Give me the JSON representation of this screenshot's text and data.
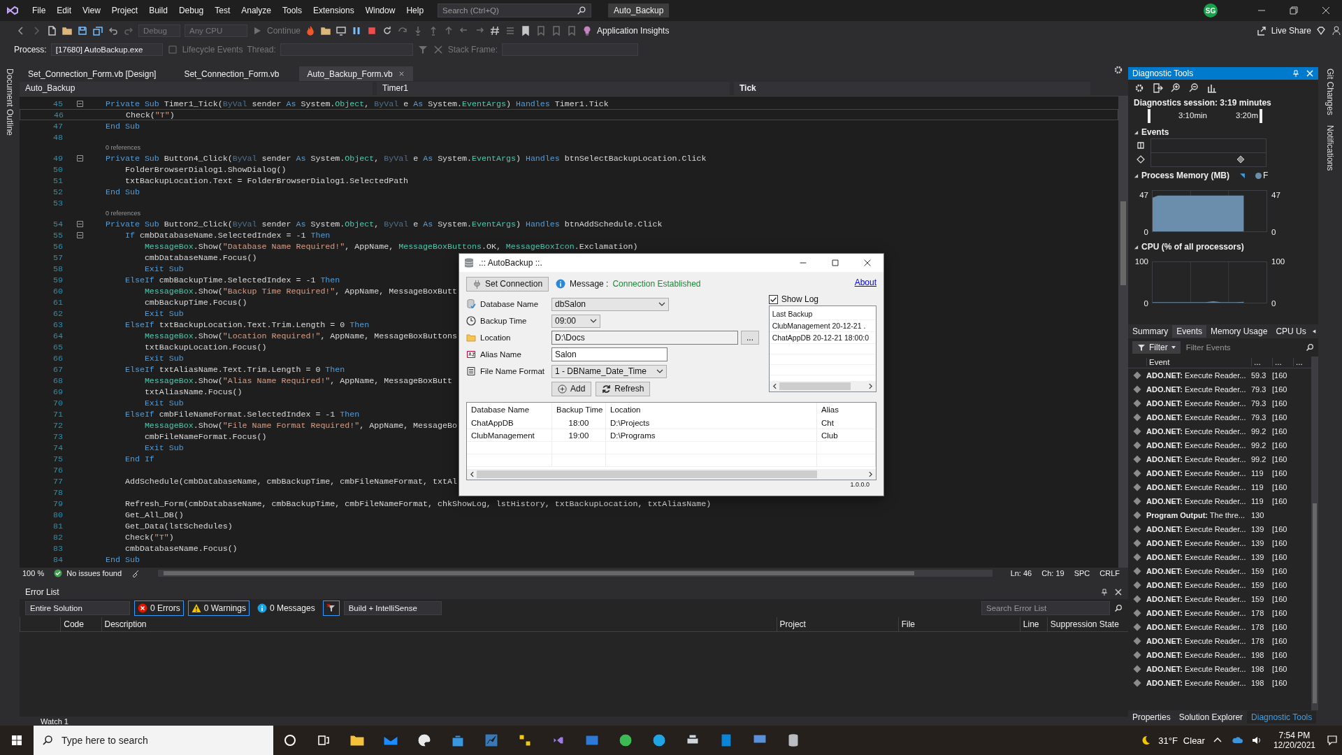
{
  "window": {
    "title": "Auto_Backup"
  },
  "menu": [
    "File",
    "Edit",
    "View",
    "Project",
    "Build",
    "Debug",
    "Test",
    "Analyze",
    "Tools",
    "Extensions",
    "Window",
    "Help"
  ],
  "search": {
    "placeholder": "Search (Ctrl+Q)"
  },
  "account": {
    "initials": "SG"
  },
  "toolbar": {
    "configuration": "Debug",
    "platform": "Any CPU",
    "continue": "Continue",
    "insights": "Application Insights",
    "live_share": "Live Share"
  },
  "debug_bar": {
    "process_label": "Process:",
    "process": "[17680] AutoBackup.exe",
    "lifecycle": "Lifecycle Events",
    "thread_label": "Thread:",
    "stack_label": "Stack Frame:"
  },
  "side_tabs_left": [
    "Document Outline"
  ],
  "side_tabs_right": [
    "Git Changes",
    "Notifications"
  ],
  "document_tabs": [
    {
      "label": "Set_Connection_Form.vb [Design]",
      "selected": false
    },
    {
      "label": "Set_Connection_Form.vb",
      "selected": false
    },
    {
      "label": "Auto_Backup_Form.vb",
      "selected": true
    }
  ],
  "navigation": {
    "project": "Auto_Backup",
    "object": "Timer1",
    "member": "Tick"
  },
  "editor": {
    "lines": [
      {
        "kind": "code",
        "n": "45",
        "fold": true,
        "current": false,
        "segs": [
          {
            "kind": "keyword",
            "text": "Private Sub "
          },
          {
            "kind": "plain",
            "text": "Timer1_Tick("
          },
          {
            "kind": "param",
            "text": "ByVal"
          },
          {
            "kind": "plain",
            "text": " sender "
          },
          {
            "kind": "keyword",
            "text": "As "
          },
          {
            "kind": "plain",
            "text": "System."
          },
          {
            "kind": "type",
            "text": "Object"
          },
          {
            "kind": "plain",
            "text": ", "
          },
          {
            "kind": "param",
            "text": "ByVal"
          },
          {
            "kind": "plain",
            "text": " e "
          },
          {
            "kind": "keyword",
            "text": "As "
          },
          {
            "kind": "plain",
            "text": "System."
          },
          {
            "kind": "type",
            "text": "EventArgs"
          },
          {
            "kind": "plain",
            "text": ") "
          },
          {
            "kind": "keyword",
            "text": "Handles "
          },
          {
            "kind": "plain",
            "text": "Timer1.Tick"
          }
        ]
      },
      {
        "kind": "code",
        "n": "46",
        "fold": false,
        "current": true,
        "segs": [
          {
            "kind": "plain",
            "text": "    Check("
          },
          {
            "kind": "string",
            "text": "\"T\""
          },
          {
            "kind": "plain",
            "text": ")"
          }
        ]
      },
      {
        "kind": "code",
        "n": "47",
        "fold": false,
        "current": false,
        "segs": [
          {
            "kind": "keyword",
            "text": "End Sub"
          }
        ]
      },
      {
        "kind": "code",
        "n": "48",
        "fold": false,
        "current": false
      },
      {
        "kind": "lens",
        "text": "0 references"
      },
      {
        "kind": "code",
        "n": "49",
        "fold": true,
        "current": false,
        "segs": [
          {
            "kind": "keyword",
            "text": "Private Sub "
          },
          {
            "kind": "plain",
            "text": "Button4_Click("
          },
          {
            "kind": "param",
            "text": "ByVal"
          },
          {
            "kind": "plain",
            "text": " sender "
          },
          {
            "kind": "keyword",
            "text": "As "
          },
          {
            "kind": "plain",
            "text": "System."
          },
          {
            "kind": "type",
            "text": "Object"
          },
          {
            "kind": "plain",
            "text": ", "
          },
          {
            "kind": "param",
            "text": "ByVal"
          },
          {
            "kind": "plain",
            "text": " e "
          },
          {
            "kind": "keyword",
            "text": "As "
          },
          {
            "kind": "plain",
            "text": "System."
          },
          {
            "kind": "type",
            "text": "EventArgs"
          },
          {
            "kind": "plain",
            "text": ") "
          },
          {
            "kind": "keyword",
            "text": "Handles "
          },
          {
            "kind": "plain",
            "text": "btnSelectBackupLocation.Click"
          }
        ]
      },
      {
        "kind": "code",
        "n": "50",
        "fold": false,
        "current": false,
        "segs": [
          {
            "kind": "plain",
            "text": "    FolderBrowserDialog1.ShowDialog()"
          }
        ]
      },
      {
        "kind": "code",
        "n": "51",
        "fold": false,
        "current": false,
        "segs": [
          {
            "kind": "plain",
            "text": "    txtBackupLocation.Text = FolderBrowserDialog1.SelectedPath"
          }
        ]
      },
      {
        "kind": "code",
        "n": "52",
        "fold": false,
        "current": false,
        "segs": [
          {
            "kind": "keyword",
            "text": "End Sub"
          }
        ]
      },
      {
        "kind": "code",
        "n": "53",
        "fold": false,
        "current": false
      },
      {
        "kind": "lens",
        "text": "0 references"
      },
      {
        "kind": "code",
        "n": "54",
        "fold": true,
        "current": false,
        "segs": [
          {
            "kind": "keyword",
            "text": "Private Sub "
          },
          {
            "kind": "plain",
            "text": "Button2_Click("
          },
          {
            "kind": "param",
            "text": "ByVal"
          },
          {
            "kind": "plain",
            "text": " sender "
          },
          {
            "kind": "keyword",
            "text": "As "
          },
          {
            "kind": "plain",
            "text": "System."
          },
          {
            "kind": "type",
            "text": "Object"
          },
          {
            "kind": "plain",
            "text": ", "
          },
          {
            "kind": "param",
            "text": "ByVal"
          },
          {
            "kind": "plain",
            "text": " e "
          },
          {
            "kind": "keyword",
            "text": "As "
          },
          {
            "kind": "plain",
            "text": "System."
          },
          {
            "kind": "type",
            "text": "EventArgs"
          },
          {
            "kind": "plain",
            "text": ") "
          },
          {
            "kind": "keyword",
            "text": "Handles "
          },
          {
            "kind": "plain",
            "text": "btnAddSchedule.Click"
          }
        ]
      },
      {
        "kind": "code",
        "n": "55",
        "fold": true,
        "current": false,
        "segs": [
          {
            "kind": "keyword",
            "text": "    If "
          },
          {
            "kind": "plain",
            "text": "cmbDatabaseName.SelectedIndex = -1 "
          },
          {
            "kind": "keyword",
            "text": "Then"
          }
        ]
      },
      {
        "kind": "code",
        "n": "56",
        "fold": false,
        "current": false,
        "segs": [
          {
            "kind": "type",
            "text": "        MessageBox"
          },
          {
            "kind": "plain",
            "text": ".Show("
          },
          {
            "kind": "string",
            "text": "\"Database Name Required!\""
          },
          {
            "kind": "plain",
            "text": ", AppName, "
          },
          {
            "kind": "type",
            "text": "MessageBoxButtons"
          },
          {
            "kind": "plain",
            "text": ".OK, "
          },
          {
            "kind": "type",
            "text": "MessageBoxIcon"
          },
          {
            "kind": "plain",
            "text": ".Exclamation)"
          }
        ]
      },
      {
        "kind": "code",
        "n": "57",
        "fold": false,
        "current": false,
        "segs": [
          {
            "kind": "plain",
            "text": "        cmbDatabaseName.Focus()"
          }
        ]
      },
      {
        "kind": "code",
        "n": "58",
        "fold": false,
        "current": false,
        "segs": [
          {
            "kind": "keyword",
            "text": "        Exit Sub"
          }
        ]
      },
      {
        "kind": "code",
        "n": "59",
        "fold": false,
        "current": false,
        "segs": [
          {
            "kind": "keyword",
            "text": "    ElseIf "
          },
          {
            "kind": "plain",
            "text": "cmbBackupTime.SelectedIndex = -1 "
          },
          {
            "kind": "keyword",
            "text": "Then"
          }
        ]
      },
      {
        "kind": "code",
        "n": "60",
        "fold": false,
        "current": false,
        "segs": [
          {
            "kind": "type",
            "text": "        MessageBox"
          },
          {
            "kind": "plain",
            "text": ".Show("
          },
          {
            "kind": "string",
            "text": "\"Backup Time Required!\""
          },
          {
            "kind": "plain",
            "text": ", AppName, MessageBoxButt"
          }
        ]
      },
      {
        "kind": "code",
        "n": "61",
        "fold": false,
        "current": false,
        "segs": [
          {
            "kind": "plain",
            "text": "        cmbBackupTime.Focus()"
          }
        ]
      },
      {
        "kind": "code",
        "n": "62",
        "fold": false,
        "current": false,
        "segs": [
          {
            "kind": "keyword",
            "text": "        Exit Sub"
          }
        ]
      },
      {
        "kind": "code",
        "n": "63",
        "fold": false,
        "current": false,
        "segs": [
          {
            "kind": "keyword",
            "text": "    ElseIf "
          },
          {
            "kind": "plain",
            "text": "txtBackupLocation.Text.Trim.Length = 0 "
          },
          {
            "kind": "keyword",
            "text": "Then"
          }
        ]
      },
      {
        "kind": "code",
        "n": "64",
        "fold": false,
        "current": false,
        "segs": [
          {
            "kind": "type",
            "text": "        MessageBox"
          },
          {
            "kind": "plain",
            "text": ".Show("
          },
          {
            "kind": "string",
            "text": "\"Location Required!\""
          },
          {
            "kind": "plain",
            "text": ", AppName, MessageBoxButtons"
          }
        ]
      },
      {
        "kind": "code",
        "n": "65",
        "fold": false,
        "current": false,
        "segs": [
          {
            "kind": "plain",
            "text": "        txtBackupLocation.Focus()"
          }
        ]
      },
      {
        "kind": "code",
        "n": "66",
        "fold": false,
        "current": false,
        "segs": [
          {
            "kind": "keyword",
            "text": "        Exit Sub"
          }
        ]
      },
      {
        "kind": "code",
        "n": "67",
        "fold": false,
        "current": false,
        "segs": [
          {
            "kind": "keyword",
            "text": "    ElseIf "
          },
          {
            "kind": "plain",
            "text": "txtAliasName.Text.Trim.Length = 0 "
          },
          {
            "kind": "keyword",
            "text": "Then"
          }
        ]
      },
      {
        "kind": "code",
        "n": "68",
        "fold": false,
        "current": false,
        "segs": [
          {
            "kind": "type",
            "text": "        MessageBox"
          },
          {
            "kind": "plain",
            "text": ".Show("
          },
          {
            "kind": "string",
            "text": "\"Alias Name Required!\""
          },
          {
            "kind": "plain",
            "text": ", AppName, MessageBoxButt"
          }
        ]
      },
      {
        "kind": "code",
        "n": "69",
        "fold": false,
        "current": false,
        "segs": [
          {
            "kind": "plain",
            "text": "        txtAliasName.Focus()"
          }
        ]
      },
      {
        "kind": "code",
        "n": "70",
        "fold": false,
        "current": false,
        "segs": [
          {
            "kind": "keyword",
            "text": "        Exit Sub"
          }
        ]
      },
      {
        "kind": "code",
        "n": "71",
        "fold": false,
        "current": false,
        "segs": [
          {
            "kind": "keyword",
            "text": "    ElseIf "
          },
          {
            "kind": "plain",
            "text": "cmbFileNameFormat.SelectedIndex = -1 "
          },
          {
            "kind": "keyword",
            "text": "Then"
          }
        ]
      },
      {
        "kind": "code",
        "n": "72",
        "fold": false,
        "current": false,
        "segs": [
          {
            "kind": "type",
            "text": "        MessageBox"
          },
          {
            "kind": "plain",
            "text": ".Show("
          },
          {
            "kind": "string",
            "text": "\"File Name Format Required!\""
          },
          {
            "kind": "plain",
            "text": ", AppName, MessageBo"
          }
        ]
      },
      {
        "kind": "code",
        "n": "73",
        "fold": false,
        "current": false,
        "segs": [
          {
            "kind": "plain",
            "text": "        cmbFileNameFormat.Focus()"
          }
        ]
      },
      {
        "kind": "code",
        "n": "74",
        "fold": false,
        "current": false,
        "segs": [
          {
            "kind": "keyword",
            "text": "        Exit Sub"
          }
        ]
      },
      {
        "kind": "code",
        "n": "75",
        "fold": false,
        "current": false,
        "segs": [
          {
            "kind": "keyword",
            "text": "    End If"
          }
        ]
      },
      {
        "kind": "code",
        "n": "76",
        "fold": false,
        "current": false
      },
      {
        "kind": "code",
        "n": "77",
        "fold": false,
        "current": false,
        "segs": [
          {
            "kind": "plain",
            "text": "    AddSchedule(cmbDatabaseName, cmbBackupTime, cmbFileNameFormat, txtAl"
          }
        ]
      },
      {
        "kind": "code",
        "n": "78",
        "fold": false,
        "current": false
      },
      {
        "kind": "code",
        "n": "79",
        "fold": false,
        "current": false,
        "segs": [
          {
            "kind": "plain",
            "text": "    Refresh_Form(cmbDatabaseName, cmbBackupTime, cmbFileNameFormat, chkShowLog, lstHistory, txtBackupLocation, txtAliasName)"
          }
        ]
      },
      {
        "kind": "code",
        "n": "80",
        "fold": false,
        "current": false,
        "segs": [
          {
            "kind": "plain",
            "text": "    Get_All_DB()"
          }
        ]
      },
      {
        "kind": "code",
        "n": "81",
        "fold": false,
        "current": false,
        "segs": [
          {
            "kind": "plain",
            "text": "    Get_Data(lstSchedules)"
          }
        ]
      },
      {
        "kind": "code",
        "n": "82",
        "fold": false,
        "current": false,
        "segs": [
          {
            "kind": "plain",
            "text": "    Check("
          },
          {
            "kind": "string",
            "text": "\"T\""
          },
          {
            "kind": "plain",
            "text": ")"
          }
        ]
      },
      {
        "kind": "code",
        "n": "83",
        "fold": false,
        "current": false,
        "segs": [
          {
            "kind": "plain",
            "text": "    cmbDatabaseName.Focus()"
          }
        ]
      },
      {
        "kind": "code",
        "n": "84",
        "fold": false,
        "current": false,
        "segs": [
          {
            "kind": "keyword",
            "text": "End Sub"
          }
        ]
      }
    ],
    "zoom": "100 %",
    "issues": "No issues found",
    "line": "Ln: 46",
    "column": "Ch: 19",
    "whitespace": "SPC",
    "line_ending": "CRLF"
  },
  "error_list": {
    "title": "Error List",
    "scope": "Entire Solution",
    "filters": [
      {
        "kind": "error",
        "label": "0 Errors",
        "selected": true
      },
      {
        "kind": "warning",
        "label": "0 Warnings",
        "selected": true
      },
      {
        "kind": "info",
        "label": "0 Messages",
        "selected": false
      }
    ],
    "source": "Build + IntelliSense",
    "search_placeholder": "Search Error List",
    "columns": [
      "Code",
      "Description",
      "Project",
      "File",
      "Line",
      "Suppression State"
    ]
  },
  "bottom_tab": "Watch 1",
  "diagnostics": {
    "title": "Diagnostic Tools",
    "session": "Diagnostics session: 3:19 minutes",
    "timeline": [
      "3:10min",
      "3:20m"
    ],
    "events_title": "Events",
    "memory": {
      "title": "Process Memory (MB)",
      "legend": "F",
      "left_axis": [
        "47",
        "0"
      ],
      "right_axis": [
        "47",
        "0"
      ]
    },
    "cpu": {
      "title": "CPU (% of all processors)",
      "right_axis": [
        "100",
        "0"
      ],
      "chart_data": {
        "type": "area",
        "categories": [
          null,
          null,
          null,
          null,
          null,
          null,
          null,
          null,
          null,
          null,
          null,
          null,
          null
        ],
        "series": [
          {
            "color": "#6a8eab",
            "values": [
              0,
              0,
              0,
              0,
              0,
              0,
              0,
              0,
              2,
              0,
              0,
              0,
              1
            ]
          }
        ],
        "ylim": [
          0,
          100
        ],
        "yticks": [
          0,
          100
        ]
      }
    },
    "tabs": [
      {
        "label": "Summary",
        "selected": false
      },
      {
        "label": "Events",
        "selected": true
      },
      {
        "label": "Memory Usage",
        "selected": false
      },
      {
        "label": "CPU Us",
        "selected": false
      }
    ],
    "filter": "Filter",
    "filter_placeholder": "Filter Events",
    "columns": [
      "Event",
      "...",
      "...",
      "..."
    ],
    "events": [
      {
        "text": "**ADO.NET:** Execute Reader...",
        "time": "59.3",
        "thread": "[160"
      },
      {
        "text": "**ADO.NET:** Execute Reader...",
        "time": "79.3",
        "thread": "[160"
      },
      {
        "text": "**ADO.NET:** Execute Reader...",
        "time": "79.3",
        "thread": "[160"
      },
      {
        "text": "**ADO.NET:** Execute Reader...",
        "time": "79.3",
        "thread": "[160"
      },
      {
        "text": "**ADO.NET:** Execute Reader...",
        "time": "99.2",
        "thread": "[160"
      },
      {
        "text": "**ADO.NET:** Execute Reader...",
        "time": "99.2",
        "thread": "[160"
      },
      {
        "text": "**ADO.NET:** Execute Reader...",
        "time": "99.2",
        "thread": "[160"
      },
      {
        "text": "**ADO.NET:** Execute Reader...",
        "time": "119",
        "thread": "[160"
      },
      {
        "text": "**ADO.NET:** Execute Reader...",
        "time": "119",
        "thread": "[160"
      },
      {
        "text": "**ADO.NET:** Execute Reader...",
        "time": "119",
        "thread": "[160"
      },
      {
        "text": "**Program Output:** The thre...",
        "time": "130"
      },
      {
        "text": "**ADO.NET:** Execute Reader...",
        "time": "139",
        "thread": "[160"
      },
      {
        "text": "**ADO.NET:** Execute Reader...",
        "time": "139",
        "thread": "[160"
      },
      {
        "text": "**ADO.NET:** Execute Reader...",
        "time": "139",
        "thread": "[160"
      },
      {
        "text": "**ADO.NET:** Execute Reader...",
        "time": "159",
        "thread": "[160"
      },
      {
        "text": "**ADO.NET:** Execute Reader...",
        "time": "159",
        "thread": "[160"
      },
      {
        "text": "**ADO.NET:** Execute Reader...",
        "time": "159",
        "thread": "[160"
      },
      {
        "text": "**ADO.NET:** Execute Reader...",
        "time": "178",
        "thread": "[160"
      },
      {
        "text": "**ADO.NET:** Execute Reader...",
        "time": "178",
        "thread": "[160"
      },
      {
        "text": "**ADO.NET:** Execute Reader...",
        "time": "178",
        "thread": "[160"
      },
      {
        "text": "**ADO.NET:** Execute Reader...",
        "time": "198",
        "thread": "[160"
      },
      {
        "text": "**ADO.NET:** Execute Reader...",
        "time": "198",
        "thread": "[160"
      },
      {
        "text": "**ADO.NET:** Execute Reader...",
        "time": "198",
        "thread": "[160"
      }
    ],
    "bottom_tabs": [
      {
        "label": "Properties",
        "selected": false
      },
      {
        "label": "Solution Explorer",
        "selected": false
      },
      {
        "label": "Diagnostic Tools",
        "selected": true
      }
    ]
  },
  "dialog": {
    "title": ".:: AutoBackup ::.",
    "connect_button": "Set Connection",
    "message_label": "Message :",
    "message": "Connection Established",
    "about_link": "About",
    "fields": [
      {
        "kind": "combo",
        "label": "Database Name",
        "value": "dbSalon"
      },
      {
        "kind": "combo",
        "label": "Backup Time",
        "value": "09:00"
      },
      {
        "kind": "readonly",
        "label": "Location",
        "value": "D:\\Docs",
        "button": "..."
      },
      {
        "kind": "text",
        "label": "Alias Name",
        "value": "Salon"
      },
      {
        "kind": "combo",
        "label": "File Name Format",
        "value": "1 - DBName_Date_Time"
      }
    ],
    "add_button": "Add",
    "refresh_button": "Refresh",
    "show_log": {
      "label": "Show Log",
      "checked": true
    },
    "log": [
      "Last Backup",
      "ClubManagement 20-12-21 .",
      "ChatAppDB 20-12-21 18:00:0"
    ],
    "schedule": {
      "columns": [
        "Database Name",
        "Backup Time",
        "Location",
        "Alias"
      ],
      "rows": [
        [
          "ChatAppDB",
          "18:00",
          "D:\\Projects",
          "Cht"
        ],
        [
          "ClubManagement",
          "19:00",
          "D:\\Programs",
          "Club"
        ]
      ]
    },
    "version": "1.0.0.0"
  },
  "taskbar": {
    "search_placeholder": "Type here to search",
    "temperature": "31°F",
    "condition": "Clear",
    "time": "7:54 PM",
    "date": "12/20/2021"
  }
}
